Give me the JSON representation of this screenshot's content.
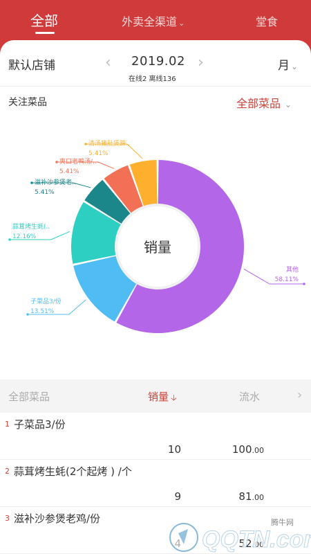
{
  "header": {
    "tabs": [
      {
        "label": "全部"
      },
      {
        "label": "外卖全渠道"
      },
      {
        "label": "堂食"
      }
    ]
  },
  "store": {
    "name": "默认店铺",
    "period": "2019.02",
    "online_info": "在线2 离线136",
    "range": "月"
  },
  "focus": {
    "title": "关注菜品",
    "filter_label": "全部菜品"
  },
  "colors": {
    "brand": "#d03a3a",
    "accent_text": "#c9433a"
  },
  "chart_data": {
    "type": "pie",
    "title": "",
    "center_label": "销量",
    "slices": [
      {
        "name": "其他",
        "label_pct": "58.11%",
        "value": 58.11,
        "color": "#b466e8"
      },
      {
        "name": "子菜品3/份",
        "label_pct": "13.51%",
        "value": 13.51,
        "color": "#4fbcf3"
      },
      {
        "name": "蒜茸烤生蚝(..",
        "label_pct": "12.16%",
        "value": 12.16,
        "color": "#2dcfc3"
      },
      {
        "name": "滋补沙参煲老..",
        "label_pct": "5.41%",
        "value": 5.41,
        "color": "#1b878a"
      },
      {
        "name": "爽口老鸭汤/..",
        "label_pct": "5.41%",
        "value": 5.41,
        "color": "#f27156"
      },
      {
        "name": "清汤猪肚煲蹄..",
        "label_pct": "5.41%",
        "value": 5.41,
        "color": "#fcb02d"
      }
    ]
  },
  "table": {
    "headers": {
      "name": "全部菜品",
      "sales": "销量",
      "flow": "流水"
    },
    "rows": [
      {
        "index": "1",
        "name": "子菜品3/份",
        "qty": "10",
        "amount_int": "100",
        "amount_dec": ".00"
      },
      {
        "index": "2",
        "name": "蒜茸烤生蚝(2个起烤 ) /个",
        "qty": "9",
        "amount_int": "81",
        "amount_dec": ".00"
      },
      {
        "index": "3",
        "name": "滋补沙参煲老鸡/份",
        "qty": "4",
        "amount_int": "52",
        "amount_dec": ".00"
      }
    ]
  },
  "watermark": {
    "text": "腾牛网",
    "logo_text": "QQTN.com"
  }
}
